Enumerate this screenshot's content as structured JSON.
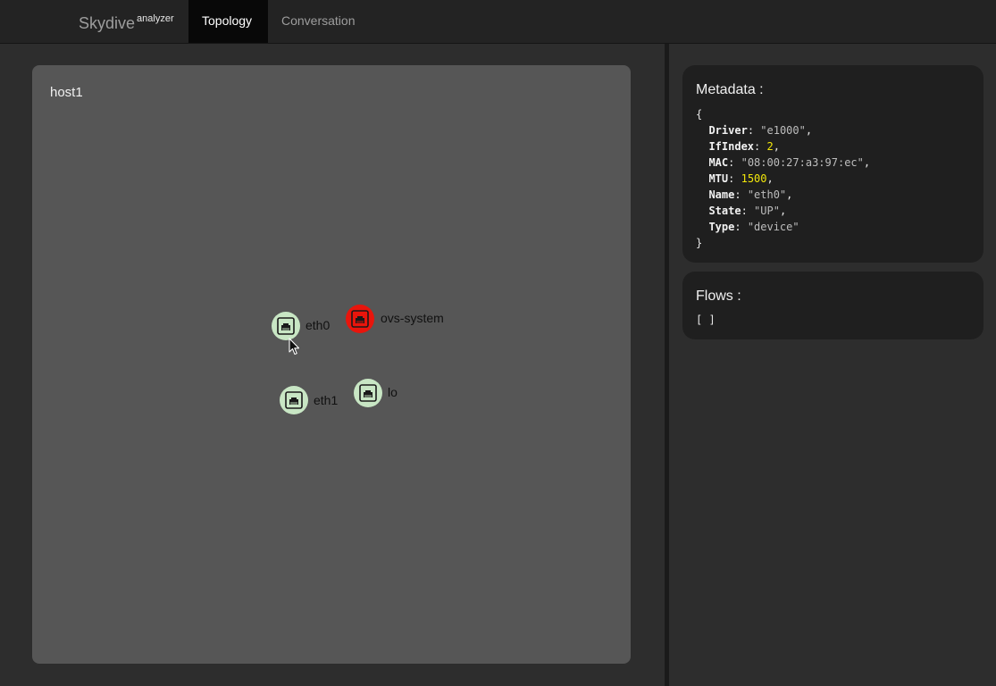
{
  "navbar": {
    "brand": "Skydive",
    "brand_sup": "analyzer",
    "tabs": [
      {
        "label": "Topology",
        "active": true
      },
      {
        "label": "Conversation",
        "active": false
      }
    ]
  },
  "topology": {
    "host": "host1",
    "nodes": [
      {
        "label": "eth0",
        "state": "up",
        "icon": "ethernet-port-icon"
      },
      {
        "label": "ovs-system",
        "state": "down",
        "icon": "ethernet-port-icon"
      },
      {
        "label": "eth1",
        "state": "up",
        "icon": "ethernet-port-icon"
      },
      {
        "label": "lo",
        "state": "up",
        "icon": "ethernet-port-icon"
      }
    ],
    "colors": {
      "node_up": "#c8e6c4",
      "node_down": "#e8150c"
    }
  },
  "metadata": {
    "title": "Metadata :",
    "open": "{",
    "close": "}",
    "entries": [
      {
        "key": "Driver",
        "value": "\"e1000\"",
        "type": "string"
      },
      {
        "key": "IfIndex",
        "value": "2",
        "type": "number"
      },
      {
        "key": "MAC",
        "value": "\"08:00:27:a3:97:ec\"",
        "type": "string"
      },
      {
        "key": "MTU",
        "value": "1500",
        "type": "number"
      },
      {
        "key": "Name",
        "value": "\"eth0\"",
        "type": "string"
      },
      {
        "key": "State",
        "value": "\"UP\"",
        "type": "string"
      },
      {
        "key": "Type",
        "value": "\"device\"",
        "type": "string"
      }
    ]
  },
  "flows": {
    "title": "Flows :",
    "value": "[ ]"
  }
}
